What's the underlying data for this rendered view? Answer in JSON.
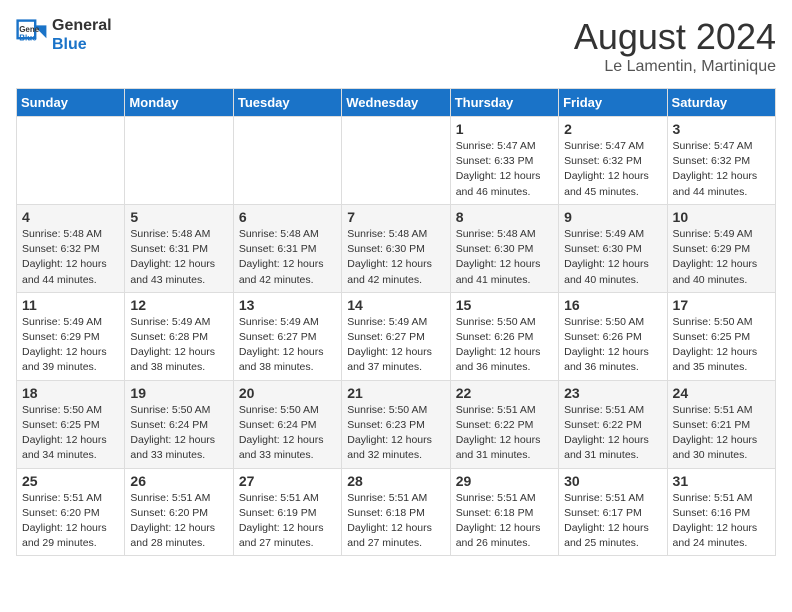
{
  "header": {
    "logo_line1": "General",
    "logo_line2": "Blue",
    "month_year": "August 2024",
    "location": "Le Lamentin, Martinique"
  },
  "days_of_week": [
    "Sunday",
    "Monday",
    "Tuesday",
    "Wednesday",
    "Thursday",
    "Friday",
    "Saturday"
  ],
  "weeks": [
    [
      {
        "day": "",
        "info": ""
      },
      {
        "day": "",
        "info": ""
      },
      {
        "day": "",
        "info": ""
      },
      {
        "day": "",
        "info": ""
      },
      {
        "day": "1",
        "info": "Sunrise: 5:47 AM\nSunset: 6:33 PM\nDaylight: 12 hours\nand 46 minutes."
      },
      {
        "day": "2",
        "info": "Sunrise: 5:47 AM\nSunset: 6:32 PM\nDaylight: 12 hours\nand 45 minutes."
      },
      {
        "day": "3",
        "info": "Sunrise: 5:47 AM\nSunset: 6:32 PM\nDaylight: 12 hours\nand 44 minutes."
      }
    ],
    [
      {
        "day": "4",
        "info": "Sunrise: 5:48 AM\nSunset: 6:32 PM\nDaylight: 12 hours\nand 44 minutes."
      },
      {
        "day": "5",
        "info": "Sunrise: 5:48 AM\nSunset: 6:31 PM\nDaylight: 12 hours\nand 43 minutes."
      },
      {
        "day": "6",
        "info": "Sunrise: 5:48 AM\nSunset: 6:31 PM\nDaylight: 12 hours\nand 42 minutes."
      },
      {
        "day": "7",
        "info": "Sunrise: 5:48 AM\nSunset: 6:30 PM\nDaylight: 12 hours\nand 42 minutes."
      },
      {
        "day": "8",
        "info": "Sunrise: 5:48 AM\nSunset: 6:30 PM\nDaylight: 12 hours\nand 41 minutes."
      },
      {
        "day": "9",
        "info": "Sunrise: 5:49 AM\nSunset: 6:30 PM\nDaylight: 12 hours\nand 40 minutes."
      },
      {
        "day": "10",
        "info": "Sunrise: 5:49 AM\nSunset: 6:29 PM\nDaylight: 12 hours\nand 40 minutes."
      }
    ],
    [
      {
        "day": "11",
        "info": "Sunrise: 5:49 AM\nSunset: 6:29 PM\nDaylight: 12 hours\nand 39 minutes."
      },
      {
        "day": "12",
        "info": "Sunrise: 5:49 AM\nSunset: 6:28 PM\nDaylight: 12 hours\nand 38 minutes."
      },
      {
        "day": "13",
        "info": "Sunrise: 5:49 AM\nSunset: 6:27 PM\nDaylight: 12 hours\nand 38 minutes."
      },
      {
        "day": "14",
        "info": "Sunrise: 5:49 AM\nSunset: 6:27 PM\nDaylight: 12 hours\nand 37 minutes."
      },
      {
        "day": "15",
        "info": "Sunrise: 5:50 AM\nSunset: 6:26 PM\nDaylight: 12 hours\nand 36 minutes."
      },
      {
        "day": "16",
        "info": "Sunrise: 5:50 AM\nSunset: 6:26 PM\nDaylight: 12 hours\nand 36 minutes."
      },
      {
        "day": "17",
        "info": "Sunrise: 5:50 AM\nSunset: 6:25 PM\nDaylight: 12 hours\nand 35 minutes."
      }
    ],
    [
      {
        "day": "18",
        "info": "Sunrise: 5:50 AM\nSunset: 6:25 PM\nDaylight: 12 hours\nand 34 minutes."
      },
      {
        "day": "19",
        "info": "Sunrise: 5:50 AM\nSunset: 6:24 PM\nDaylight: 12 hours\nand 33 minutes."
      },
      {
        "day": "20",
        "info": "Sunrise: 5:50 AM\nSunset: 6:24 PM\nDaylight: 12 hours\nand 33 minutes."
      },
      {
        "day": "21",
        "info": "Sunrise: 5:50 AM\nSunset: 6:23 PM\nDaylight: 12 hours\nand 32 minutes."
      },
      {
        "day": "22",
        "info": "Sunrise: 5:51 AM\nSunset: 6:22 PM\nDaylight: 12 hours\nand 31 minutes."
      },
      {
        "day": "23",
        "info": "Sunrise: 5:51 AM\nSunset: 6:22 PM\nDaylight: 12 hours\nand 31 minutes."
      },
      {
        "day": "24",
        "info": "Sunrise: 5:51 AM\nSunset: 6:21 PM\nDaylight: 12 hours\nand 30 minutes."
      }
    ],
    [
      {
        "day": "25",
        "info": "Sunrise: 5:51 AM\nSunset: 6:20 PM\nDaylight: 12 hours\nand 29 minutes."
      },
      {
        "day": "26",
        "info": "Sunrise: 5:51 AM\nSunset: 6:20 PM\nDaylight: 12 hours\nand 28 minutes."
      },
      {
        "day": "27",
        "info": "Sunrise: 5:51 AM\nSunset: 6:19 PM\nDaylight: 12 hours\nand 27 minutes."
      },
      {
        "day": "28",
        "info": "Sunrise: 5:51 AM\nSunset: 6:18 PM\nDaylight: 12 hours\nand 27 minutes."
      },
      {
        "day": "29",
        "info": "Sunrise: 5:51 AM\nSunset: 6:18 PM\nDaylight: 12 hours\nand 26 minutes."
      },
      {
        "day": "30",
        "info": "Sunrise: 5:51 AM\nSunset: 6:17 PM\nDaylight: 12 hours\nand 25 minutes."
      },
      {
        "day": "31",
        "info": "Sunrise: 5:51 AM\nSunset: 6:16 PM\nDaylight: 12 hours\nand 24 minutes."
      }
    ]
  ]
}
